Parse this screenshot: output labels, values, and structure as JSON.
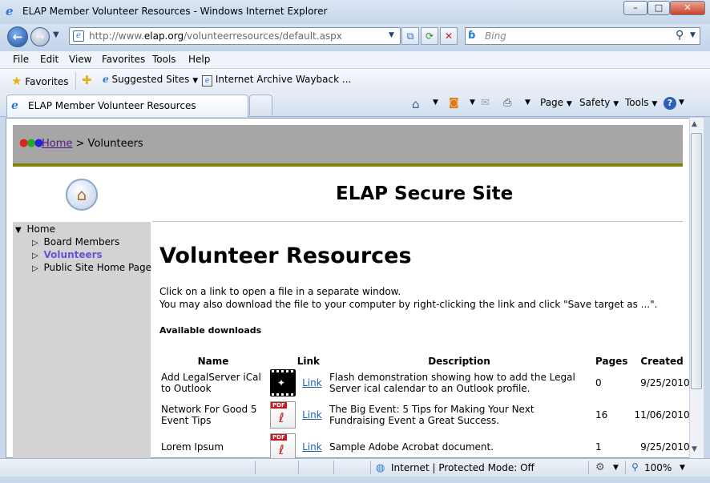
{
  "window": {
    "title": "ELAP Member Volunteer Resources - Windows Internet Explorer"
  },
  "navigation": {
    "url_prefix": "http://www.",
    "url_host": "elap.org",
    "url_path": "/volunteerresources/default.aspx",
    "search_placeholder": "Bing"
  },
  "menu": [
    "File",
    "Edit",
    "View",
    "Favorites",
    "Tools",
    "Help"
  ],
  "favorites_bar": {
    "favorites_label": "Favorites",
    "suggested_label": "Suggested Sites",
    "wayback_label": "Internet Archive Wayback ..."
  },
  "tabs": {
    "active_label": "ELAP Member Volunteer Resources"
  },
  "command_bar": {
    "page": "Page",
    "safety": "Safety",
    "tools": "Tools"
  },
  "page": {
    "breadcrumb_home": "Home",
    "breadcrumb_current": "> Volunteers",
    "site_title": "ELAP Secure Site",
    "sidebar": {
      "root": "Home",
      "items": [
        "Board Members",
        "Volunteers",
        "Public Site Home Page"
      ]
    },
    "heading": "Volunteer Resources",
    "intro_line1": "Click on a link to open a file in a separate window.",
    "intro_line2": "You may also download the file to your computer by right-clicking the link and click \"Save target as ...\".",
    "downloads_label": "Available downloads",
    "table": {
      "headers": [
        "Name",
        "Link",
        "Description",
        "Pages",
        "Created"
      ],
      "rows": [
        {
          "name": "Add LegalServer iCal to Outlook",
          "icon": "flash-file-icon",
          "link": "Link",
          "description": "Flash demonstration showing how to add the Legal Server ical calendar to an Outlook profile.",
          "pages": "0",
          "created": "9/25/2010"
        },
        {
          "name": "Network For Good 5 Event Tips",
          "icon": "pdf-file-icon",
          "link": "Link",
          "description": "The Big Event: 5 Tips for Making Your Next Fundraising Event a Great Success.",
          "pages": "16",
          "created": "11/06/2010"
        },
        {
          "name": "Lorem Ipsum",
          "icon": "pdf-file-icon",
          "link": "Link",
          "description": "Sample Adobe Acrobat document.",
          "pages": "1",
          "created": "9/25/2010"
        }
      ]
    }
  },
  "status": {
    "zone": "Internet | Protected Mode: Off",
    "zoom": "100%"
  },
  "colors": {
    "link_active": "#6b4fd8",
    "olive": "#818108",
    "header_gray": "#a6a6a6"
  }
}
